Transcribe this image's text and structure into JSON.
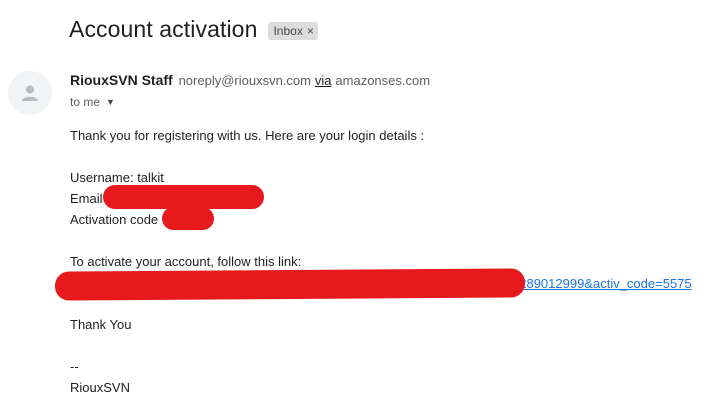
{
  "email": {
    "subject": "Account activation",
    "label": "Inbox",
    "label_close": "×",
    "sender_name": "RiouxSVN Staff",
    "sender_email": "noreply@riouxsvn.com",
    "via_text": "via",
    "via_domain": "amazonses.com",
    "to_text": "to me",
    "caret": "▼",
    "body": {
      "line1": "Thank you for registering with us. Here are your login details :",
      "username": "Username: talkit",
      "email_label": "Email",
      "activation_label": "Activation code",
      "activate_intro": "To activate your account, follow this link:",
      "link_tail": "b289012999&activ_code=5575",
      "thanks": "Thank You",
      "sig_dash": "--",
      "sig_name": "RiouxSVN"
    }
  },
  "colors": {
    "redaction": "#e8191c",
    "link": "#1a73e8"
  },
  "icons": {
    "avatar": "person-icon"
  }
}
